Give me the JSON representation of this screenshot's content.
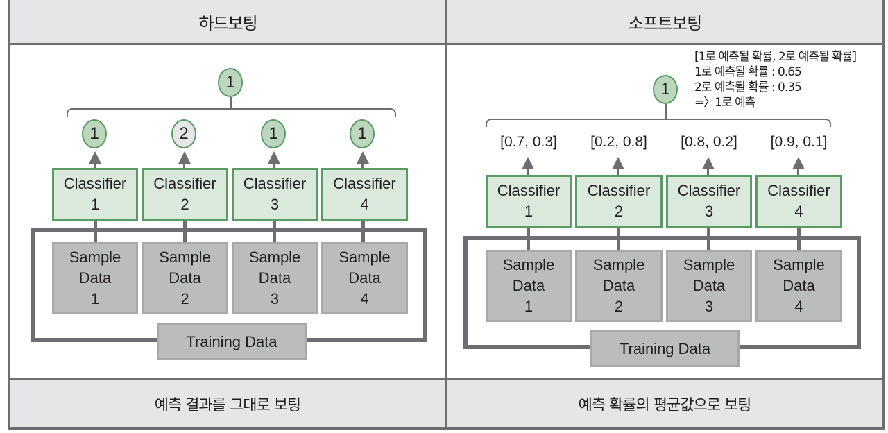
{
  "header": {
    "left_title": "하드보팅",
    "right_title": "소프트보팅"
  },
  "footer": {
    "left_caption": "예측 결과를 그대로 보팅",
    "right_caption": "예측 확률의 평균값으로 보팅"
  },
  "colors": {
    "border": "#6d6e71",
    "header_bg": "#e6e6e8",
    "classifier_fill": "#dbe8dc",
    "classifier_border": "#5a9a64",
    "vote_circle_fill": "#bdd7be",
    "sample_fill": "#bbbcbe"
  },
  "hard_voting": {
    "final_prediction": "1",
    "votes": [
      "1",
      "2",
      "1",
      "1"
    ],
    "classifiers": [
      {
        "line1": "Classifier",
        "line2": "1"
      },
      {
        "line1": "Classifier",
        "line2": "2"
      },
      {
        "line1": "Classifier",
        "line2": "3"
      },
      {
        "line1": "Classifier",
        "line2": "4"
      }
    ],
    "samples": [
      {
        "line1": "Sample",
        "line2": "Data",
        "line3": "1"
      },
      {
        "line1": "Sample",
        "line2": "Data",
        "line3": "2"
      },
      {
        "line1": "Sample",
        "line2": "Data",
        "line3": "3"
      },
      {
        "line1": "Sample",
        "line2": "Data",
        "line3": "4"
      }
    ],
    "training_label": "Training Data"
  },
  "soft_voting": {
    "final_prediction": "1",
    "annotation": [
      "[1로 예측될 확률, 2로 예측될 확률]",
      "1로 예측될 확률 : 0.65",
      "2로 예측될 확률 : 0.35",
      "=〉1로 예측"
    ],
    "probabilities": [
      "[0.7, 0.3]",
      "[0.2, 0.8]",
      "[0.8, 0.2]",
      "[0.9, 0.1]"
    ],
    "classifiers": [
      {
        "line1": "Classifier",
        "line2": "1"
      },
      {
        "line1": "Classifier",
        "line2": "2"
      },
      {
        "line1": "Classifier",
        "line2": "3"
      },
      {
        "line1": "Classifier",
        "line2": "4"
      }
    ],
    "samples": [
      {
        "line1": "Sample",
        "line2": "Data",
        "line3": "1"
      },
      {
        "line1": "Sample",
        "line2": "Data",
        "line3": "2"
      },
      {
        "line1": "Sample",
        "line2": "Data",
        "line3": "3"
      },
      {
        "line1": "Sample",
        "line2": "Data",
        "line3": "4"
      }
    ],
    "training_label": "Training Data"
  }
}
